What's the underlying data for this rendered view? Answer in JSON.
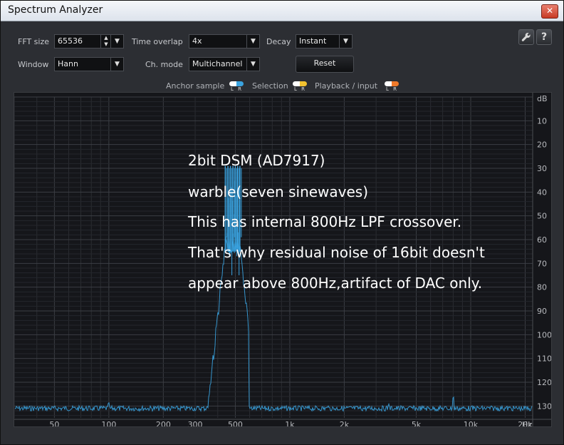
{
  "window": {
    "title": "Spectrum Analyzer",
    "close_glyph": "✕"
  },
  "controls": {
    "fft_size": {
      "label": "FFT size",
      "value": "65536"
    },
    "time_overlap": {
      "label": "Time overlap",
      "value": "4x"
    },
    "decay": {
      "label": "Decay",
      "value": "Instant"
    },
    "window_fn": {
      "label": "Window",
      "value": "Hann"
    },
    "ch_mode": {
      "label": "Ch. mode",
      "value": "Multichannel"
    },
    "reset_label": "Reset",
    "settings_icon": "wrench-icon",
    "help_glyph": "?"
  },
  "legend": {
    "anchor_label": "Anchor sample",
    "selection_label": "Selection",
    "playback_label": "Playback / input",
    "lr": "L R",
    "colors": {
      "anchor": "#3aa3e0",
      "selection": "#f2c230",
      "playback": "#f07a2a"
    }
  },
  "annotation": {
    "line1": "2bit DSM (AD7917)",
    "line2": "warble(seven sinewaves)",
    "line3": "This has internal 800Hz LPF crossover.",
    "line4": "That's why residual noise of 16bit doesn't",
    "line5": "appear above 800Hz,artifact of DAC only."
  },
  "chart_data": {
    "type": "line",
    "x_scale": "log",
    "xlim": [
      30,
      22000
    ],
    "ylim": [
      0,
      135
    ],
    "y_unit": "dB",
    "y_inverted": true,
    "x_ticks": [
      {
        "v": 50,
        "label": "50"
      },
      {
        "v": 100,
        "label": "100"
      },
      {
        "v": 200,
        "label": "200"
      },
      {
        "v": 300,
        "label": "300"
      },
      {
        "v": 500,
        "label": "500"
      },
      {
        "v": 1000,
        "label": "1k"
      },
      {
        "v": 2000,
        "label": "2k"
      },
      {
        "v": 5000,
        "label": "5k"
      },
      {
        "v": 10000,
        "label": "10k"
      },
      {
        "v": 20000,
        "label": "20k"
      }
    ],
    "x_unit": "Hz",
    "y_ticks": [
      10,
      20,
      30,
      40,
      50,
      60,
      70,
      80,
      90,
      100,
      110,
      120,
      130
    ],
    "grid": true,
    "series": [
      {
        "color": "#3aa3e0",
        "noise_floor_db": 131,
        "tones_hz": [
          440,
          455,
          470,
          485,
          500,
          515,
          530
        ],
        "tone_peak_db": 29,
        "skirt_db": 60,
        "spurs": [
          {
            "hz": 100,
            "db": 128
          },
          {
            "hz": 1620,
            "db": 130
          },
          {
            "hz": 3500,
            "db": 129
          },
          {
            "hz": 8000,
            "db": 126
          },
          {
            "hz": 15000,
            "db": 130
          }
        ]
      }
    ]
  }
}
